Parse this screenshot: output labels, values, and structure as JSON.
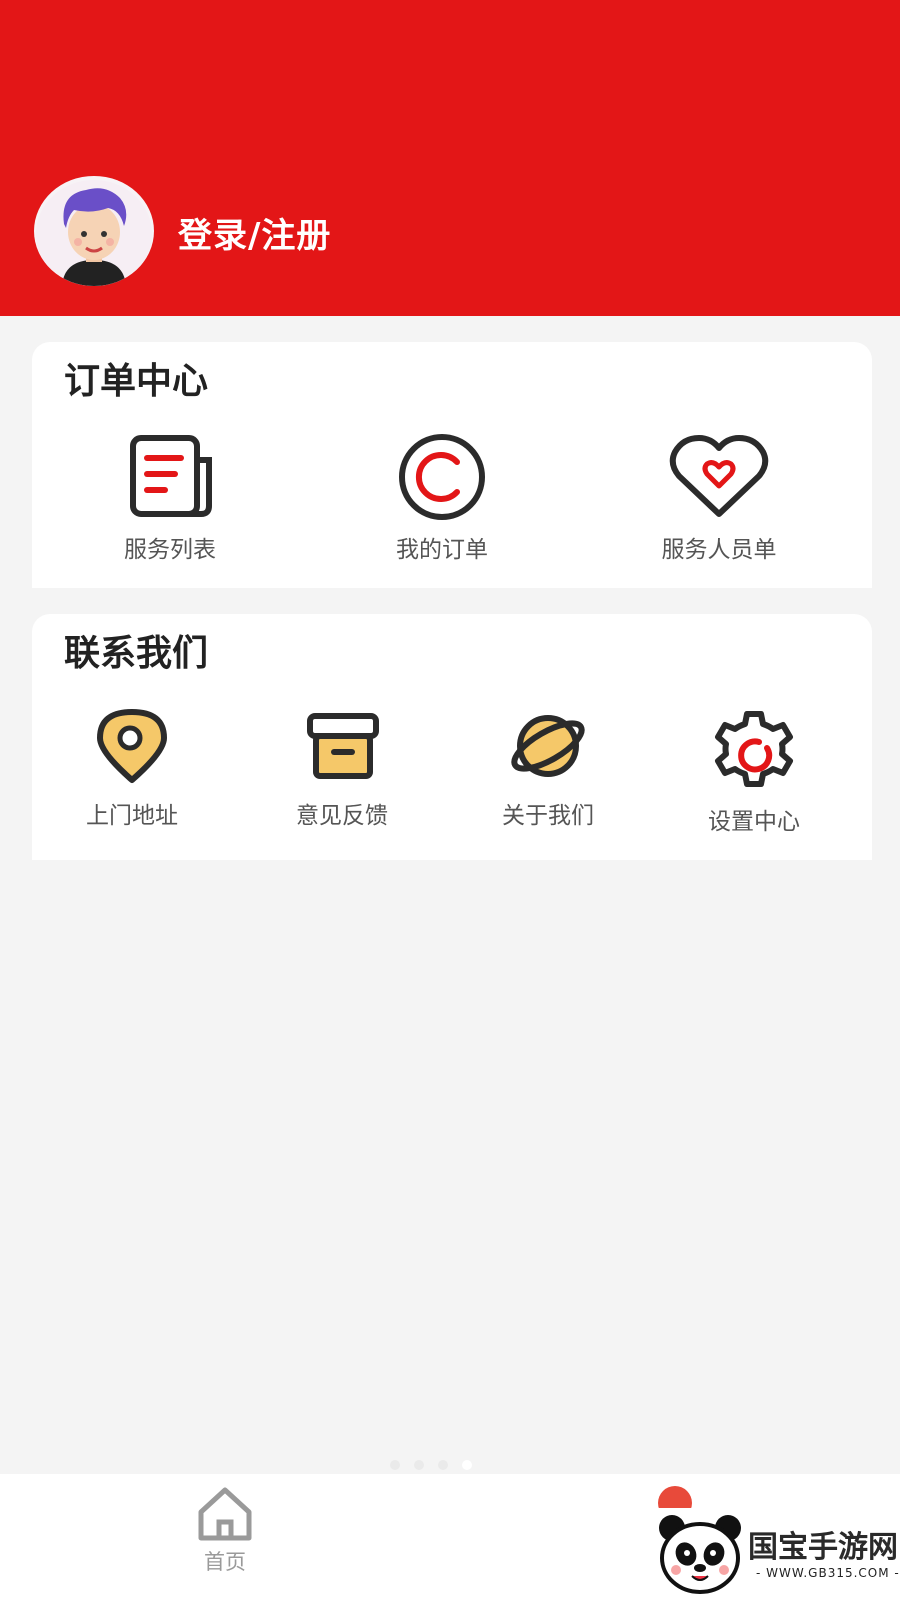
{
  "profile": {
    "login_label": "登录/注册"
  },
  "order_center": {
    "title": "订单中心",
    "items": [
      {
        "label": "服务列表",
        "icon": "document-list-icon"
      },
      {
        "label": "我的订单",
        "icon": "copyright-circle-icon"
      },
      {
        "label": "服务人员单",
        "icon": "heart-icon"
      }
    ]
  },
  "contact": {
    "title": "联系我们",
    "items": [
      {
        "label": "上门地址",
        "icon": "location-pin-icon"
      },
      {
        "label": "意见反馈",
        "icon": "archive-box-icon"
      },
      {
        "label": "关于我们",
        "icon": "planet-icon"
      },
      {
        "label": "设置中心",
        "icon": "gear-icon"
      }
    ]
  },
  "tabbar": {
    "home_label": "首页"
  },
  "watermark": {
    "brand": "国宝手游网",
    "url": "- WWW.GB315.COM -"
  },
  "colors": {
    "accent": "#e31617",
    "card": "#ffffff",
    "page_bg": "#f4f4f4",
    "icon_yellow": "#f5c869"
  }
}
